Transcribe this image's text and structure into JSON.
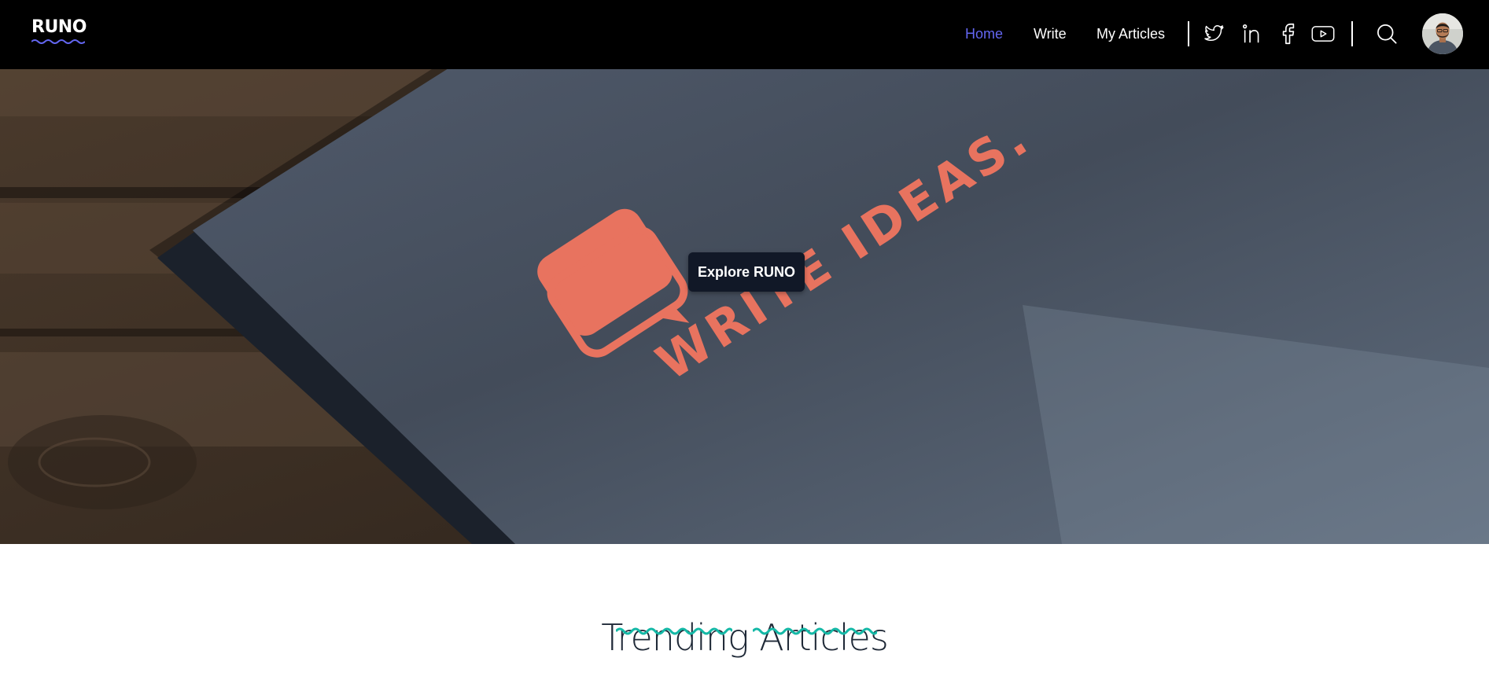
{
  "brand": {
    "name": "RUNO"
  },
  "nav": {
    "items": [
      {
        "label": "Home",
        "active": true
      },
      {
        "label": "Write",
        "active": false
      },
      {
        "label": "My Articles",
        "active": false
      }
    ]
  },
  "social": {
    "icons": [
      "twitter-icon",
      "linkedin-icon",
      "facebook-icon",
      "youtube-icon"
    ]
  },
  "search": {
    "icon": "search-icon"
  },
  "user": {
    "avatar": "user-avatar"
  },
  "hero": {
    "cta_label": "Explore RUNO",
    "notebook_text": "WRITE IDEAS."
  },
  "trending": {
    "title": "Trending Articles"
  },
  "colors": {
    "header_bg": "#000000",
    "nav_active": "#6366f1",
    "nav_default": "#ffffff",
    "accent_wave": "#14b8a6",
    "logo_wave": "#6366f1",
    "cta_bg": "#111827",
    "notebook_logo": "#e8735f"
  }
}
